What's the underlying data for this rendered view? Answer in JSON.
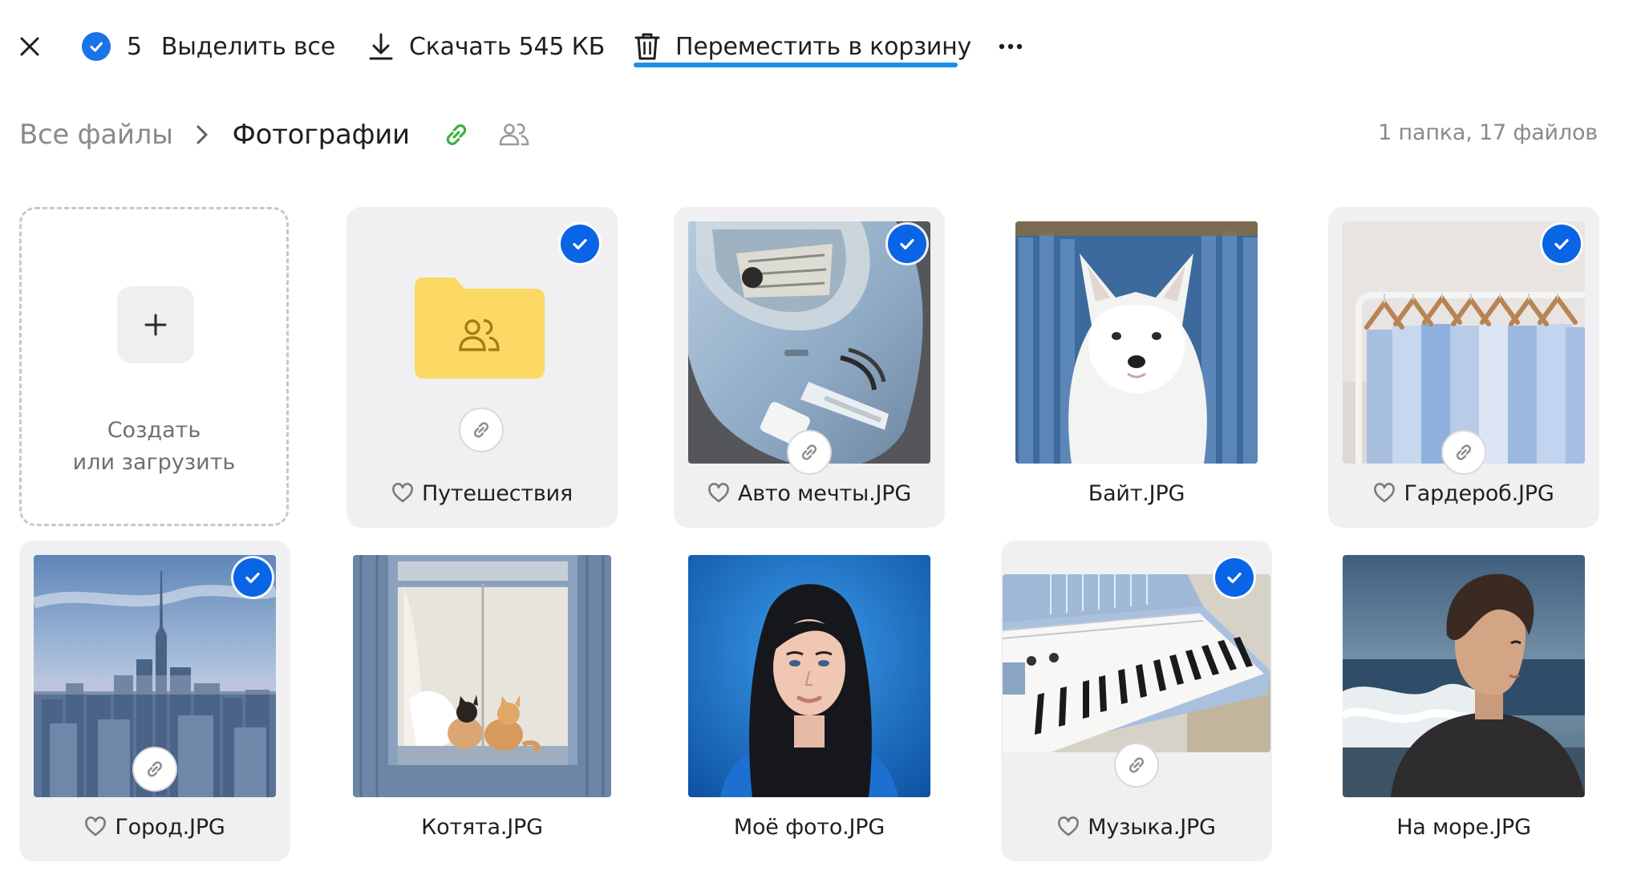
{
  "toolbar": {
    "selected_count": "5",
    "select_all_label": "Выделить все",
    "download_label": "Скачать 545 КБ",
    "trash_label": "Переместить в корзину"
  },
  "breadcrumb": {
    "root": "Все файлы",
    "current": "Фотографии"
  },
  "summary": "1 папка, 17 файлов",
  "create_tile": {
    "line1": "Создать",
    "line2": "или загрузить"
  },
  "items": [
    {
      "name": "Путешествия",
      "type": "folder",
      "selected": true,
      "favorite_icon": true,
      "shared_link": true
    },
    {
      "name": "Авто мечты.JPG",
      "type": "image",
      "selected": true,
      "favorite_icon": true,
      "shared_link": true
    },
    {
      "name": "Байт.JPG",
      "type": "image",
      "selected": false,
      "favorite_icon": false,
      "shared_link": false
    },
    {
      "name": "Гардероб.JPG",
      "type": "image",
      "selected": true,
      "favorite_icon": true,
      "shared_link": true
    },
    {
      "name": "Город.JPG",
      "type": "image",
      "selected": true,
      "favorite_icon": true,
      "shared_link": true
    },
    {
      "name": "Котята.JPG",
      "type": "image",
      "selected": false,
      "favorite_icon": false,
      "shared_link": false
    },
    {
      "name": "Моё фото.JPG",
      "type": "image",
      "selected": false,
      "favorite_icon": false,
      "shared_link": false
    },
    {
      "name": "Музыка.JPG",
      "type": "image",
      "selected": true,
      "favorite_icon": true,
      "shared_link": true
    },
    {
      "name": "На море.JPG",
      "type": "image",
      "selected": false,
      "favorite_icon": false,
      "shared_link": false
    }
  ],
  "colors": {
    "accent": "#1a73e8",
    "selection_check": "#0a64e6",
    "underline": "#1a8fe8",
    "link_icon_green": "#3cb043",
    "folder": "#fcd964",
    "folder_icon": "#a87b12",
    "selected_tile_bg": "#f0f0f2"
  }
}
